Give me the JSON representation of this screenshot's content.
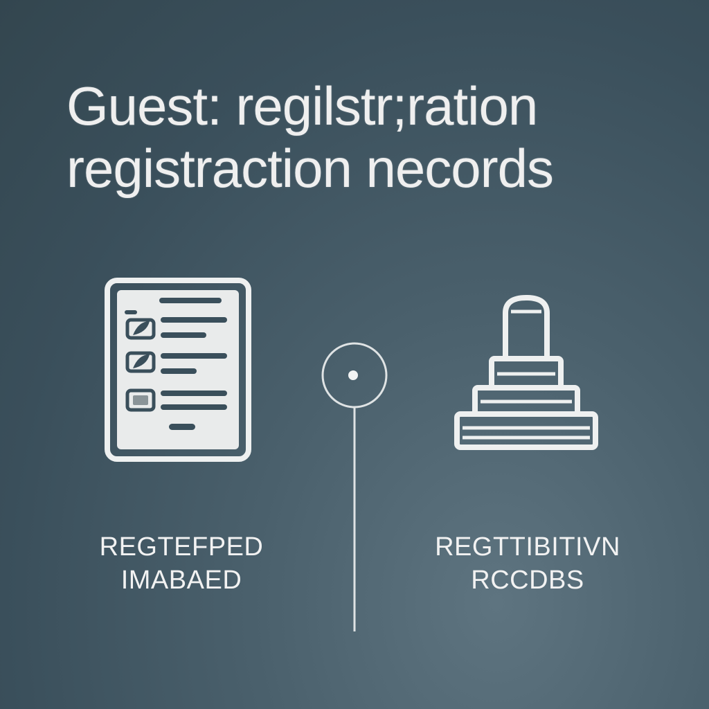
{
  "title": {
    "line1": "Guest: regilstr;ration",
    "line2": "registraction necords"
  },
  "left": {
    "icon": "checklist-icon",
    "caption_line1": "REGTEFPED",
    "caption_line2": "IMABAED"
  },
  "center": {
    "icon": "timeline-node-icon"
  },
  "right": {
    "icon": "stamp-icon",
    "caption_line1": "REGTTIBITIVN",
    "caption_line2": "RCCDBS"
  },
  "colors": {
    "background": "#3f5561",
    "foreground": "#eceeef"
  }
}
